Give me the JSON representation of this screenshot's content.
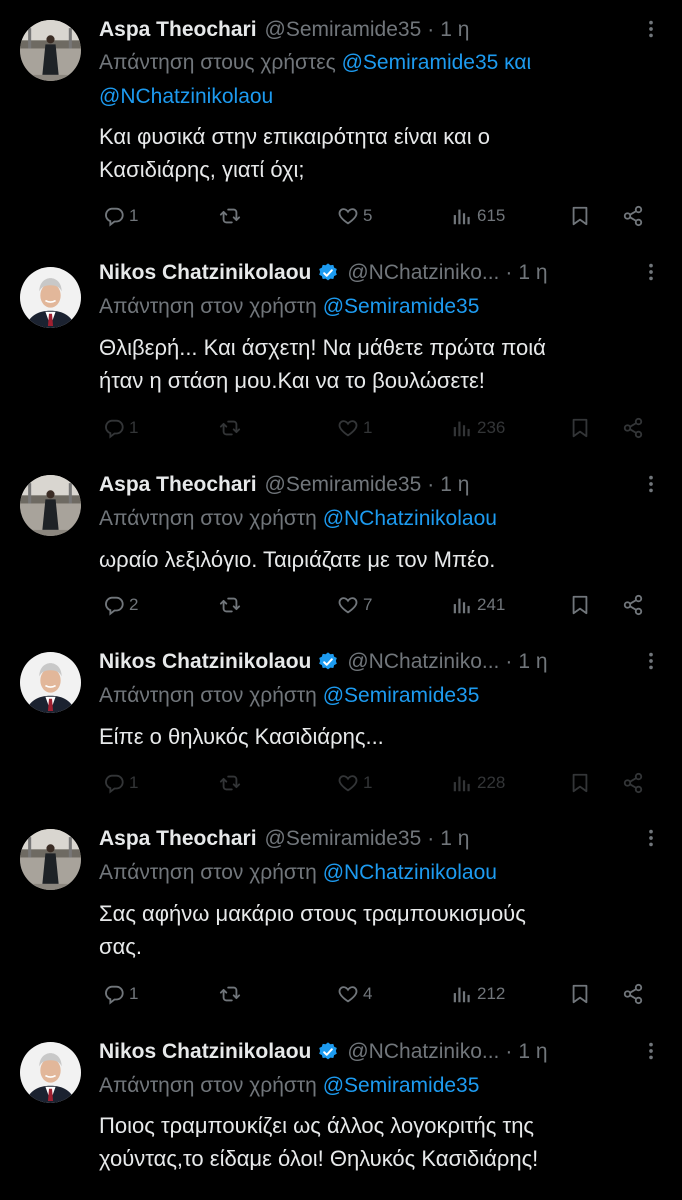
{
  "tweets": [
    {
      "author": "Aspa Theochari",
      "handle": "@Semiramide35",
      "verified": false,
      "time": "1 η",
      "reply_prefix": "Απάντηση στους χρήστες",
      "reply_mention_1": "@Semiramide35",
      "reply_joiner": "και",
      "reply_mention_2": "@NChatzinikolaou",
      "text_line_1": "Και φυσικά στην επικαιρότητα είναι και ο",
      "text_line_2": "Κασιδιάρης, γιατί όχι;",
      "replies": "1",
      "retweets": "",
      "likes": "5",
      "views": "615"
    },
    {
      "author": "Nikos Chatzinikolaou",
      "handle": "@NChatziniko...",
      "verified": true,
      "time": "1 η",
      "reply_prefix": "Απάντηση στον χρήστη",
      "reply_mention_1": "@Semiramide35",
      "text_line_1": "Θλιβερή... Και άσχετη! Να μάθετε πρώτα ποιά",
      "text_line_2": "ήταν η στάση μου.Και να το  βουλώσετε!",
      "replies": "1",
      "retweets": "",
      "likes": "1",
      "views": "236"
    },
    {
      "author": "Aspa Theochari",
      "handle": "@Semiramide35",
      "verified": false,
      "time": "1 η",
      "reply_prefix": "Απάντηση στον χρήστη",
      "reply_mention_1": "@NChatzinikolaou",
      "text_line_1": "ωραίο λεξιλόγιο. Ταιριάζατε με τον Μπέο.",
      "replies": "2",
      "retweets": "",
      "likes": "7",
      "views": "241"
    },
    {
      "author": "Nikos Chatzinikolaou",
      "handle": "@NChatziniko...",
      "verified": true,
      "time": "1 η",
      "reply_prefix": "Απάντηση στον χρήστη",
      "reply_mention_1": "@Semiramide35",
      "text_line_1": "Είπε ο θηλυκός Κασιδιάρης...",
      "replies": "1",
      "retweets": "",
      "likes": "1",
      "views": "228"
    },
    {
      "author": "Aspa Theochari",
      "handle": "@Semiramide35",
      "verified": false,
      "time": "1 η",
      "reply_prefix": "Απάντηση στον χρήστη",
      "reply_mention_1": "@NChatzinikolaou",
      "text_line_1": "Σας αφήνω μακάριο στους τραμπουκισμούς",
      "text_line_2": "σας.",
      "replies": "1",
      "retweets": "",
      "likes": "4",
      "views": "212"
    },
    {
      "author": "Nikos Chatzinikolaou",
      "handle": "@NChatziniko...",
      "verified": true,
      "time": "1 η",
      "reply_prefix": "Απάντηση στον χρήστη",
      "reply_mention_1": "@Semiramide35",
      "text_line_1": "Ποιος τραμπουκίζει ως άλλος λογοκριτής της",
      "text_line_2": "χούντας,το είδαμε όλοι! Θηλυκός Κασιδιάρης!"
    }
  ],
  "colors": {
    "background": "#000000",
    "text": "#e7e9ea",
    "muted": "#71767b",
    "link": "#1d9bf0",
    "verified": "#1d9bf0"
  },
  "icons": {
    "reply": "reply-icon",
    "retweet": "retweet-icon",
    "like": "heart-icon",
    "views": "views-icon",
    "bookmark": "bookmark-icon",
    "share": "share-icon",
    "more": "more-icon",
    "verified": "verified-badge-icon"
  }
}
